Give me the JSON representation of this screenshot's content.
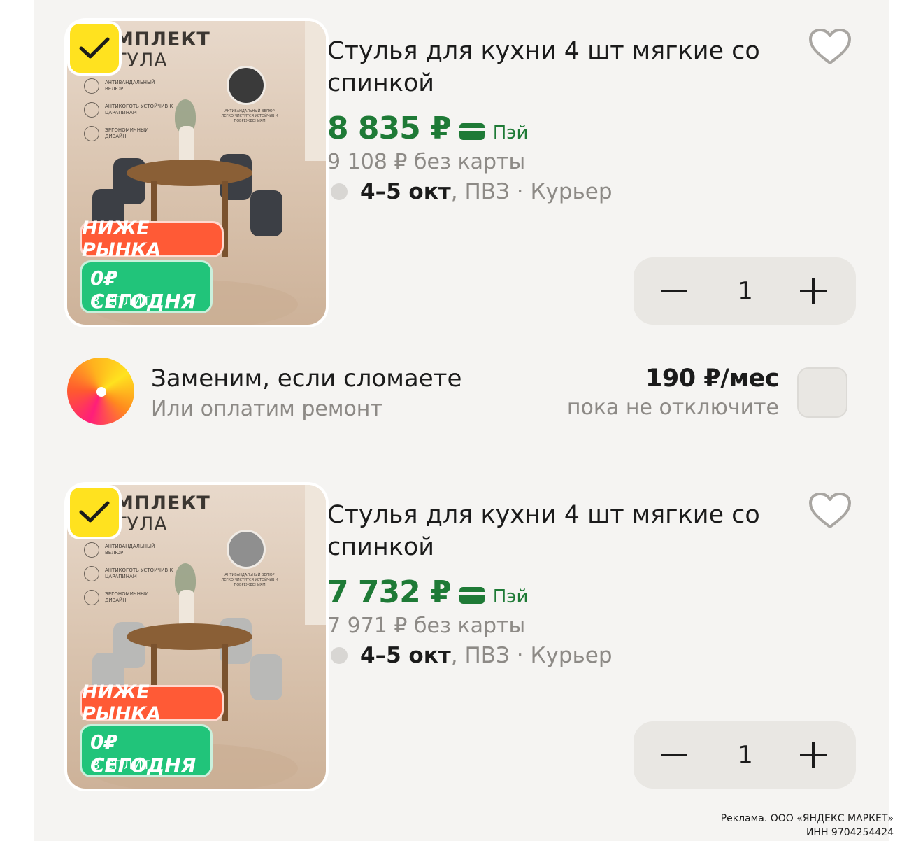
{
  "products": [
    {
      "image": {
        "title_lines": [
          "МПЛЕКТ",
          "ТУЛА"
        ],
        "features": [
          "АНТИВАНДАЛЬНЫЙ ВЕЛЮР",
          "АНТИКОГОТЬ УСТОЙЧИВ К ЦАРАПИНАМ",
          "ЭРГОНОМИЧНЫЙ ДИЗАЙН"
        ],
        "swatch_note": "АНТИВАНДАЛЬНЫЙ ВЕЛЮР ЛЕГКО ЧИСТИТСЯ УСТОЙЧИВ К ПОВРЕЖДЕНИЯМ",
        "swatch_color": "#3a3a3a",
        "chair_color": "#3c3f45",
        "sticker_red": "НИЖЕ РЫНКА",
        "sticker_green_big": "0₽ СЕГОДНЯ",
        "sticker_green_small": "В СПЛИТ"
      },
      "title": "Стулья для кухни 4 шт мягкие со спинкой",
      "price": "8 835 ₽",
      "pay_label": "Пэй",
      "old_price": "9 108 ₽  без карты",
      "delivery_date": "4–5 окт",
      "delivery_rest": ", ПВЗ · Курьер",
      "quantity": "1",
      "favorite_icon": "heart-outline-icon"
    },
    {
      "image": {
        "title_lines": [
          "МПЛЕКТ",
          "ТУЛА"
        ],
        "features": [
          "АНТИВАНДАЛЬНЫЙ ВЕЛЮР",
          "АНТИКОГОТЬ УСТОЙЧИВ К ЦАРАПИНАМ",
          "ЭРГОНОМИЧНЫЙ ДИЗАЙН"
        ],
        "swatch_note": "АНТИВАНДАЛЬНЫЙ ВЕЛЮР ЛЕГКО ЧИСТИТСЯ УСТОЙЧИВ К ПОВРЕЖДЕНИЯМ",
        "swatch_color": "#8f8f8f",
        "chair_color": "#b9b9b7",
        "sticker_red": "НИЖЕ РЫНКА",
        "sticker_green_big": "0₽ СЕГОДНЯ",
        "sticker_green_small": "В СПЛИТ"
      },
      "title": "Стулья для кухни 4 шт мягкие со спинкой",
      "price": "7 732 ₽",
      "pay_label": "Пэй",
      "old_price": "7 971 ₽  без карты",
      "delivery_date": "4–5 окт",
      "delivery_rest": ", ПВЗ · Курьер",
      "quantity": "1",
      "favorite_icon": "heart-outline-icon"
    }
  ],
  "insurance": {
    "title": "Заменим, если сломаете",
    "subtitle": "Или оплатим ремонт",
    "price": "190 ₽/мес",
    "note": "пока не отключите"
  },
  "ad_disclaimer": {
    "line1": "Реклама. ООО «ЯНДЕКС МАРКЕТ»",
    "line2": "ИНН 9704254424"
  },
  "colors": {
    "accent_green": "#1e7a36",
    "check_yellow": "#ffe21f",
    "sticker_red": "#ff5a36",
    "sticker_green": "#21c47a"
  }
}
